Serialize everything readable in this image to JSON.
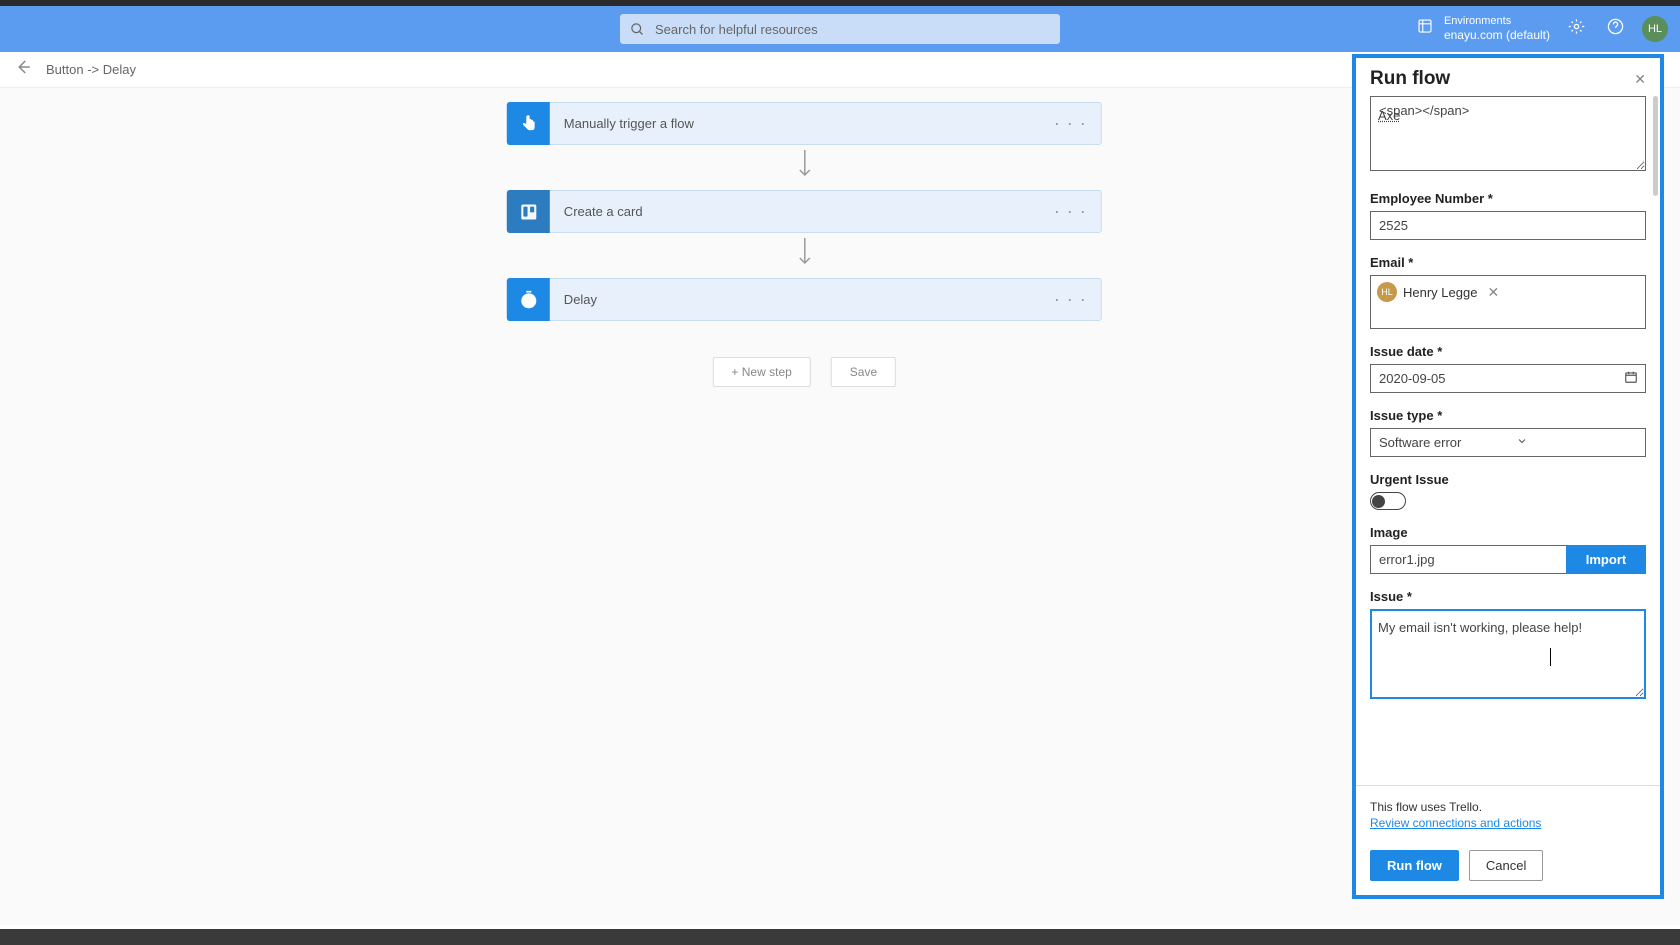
{
  "header": {
    "search_placeholder": "Search for helpful resources",
    "env_label": "Environments",
    "env_value": "enayu.com (default)",
    "avatar_initials": "HL"
  },
  "breadcrumb": {
    "text": "Button -> Delay"
  },
  "flow": {
    "steps": [
      {
        "label": "Manually trigger a flow",
        "icon": "touch"
      },
      {
        "label": "Create a card",
        "icon": "trello"
      },
      {
        "label": "Delay",
        "icon": "clock"
      }
    ],
    "new_step": "+ New step",
    "save": "Save"
  },
  "panel": {
    "title": "Run flow",
    "top_text": "Axe",
    "emp_num_label": "Employee Number *",
    "emp_num_value": "2525",
    "email_label": "Email *",
    "email_pill": "Henry Legge",
    "email_pill_initials": "HL",
    "issue_date_label": "Issue date *",
    "issue_date_value": "2020-09-05",
    "issue_type_label": "Issue type *",
    "issue_type_value": "Software error",
    "urgent_label": "Urgent Issue",
    "image_label": "Image",
    "image_value": "error1.jpg",
    "import_btn": "Import",
    "issue_label": "Issue *",
    "issue_value": "My email isn't working, please help!",
    "foot_text": "This flow uses Trello.",
    "foot_link": "Review connections and actions",
    "run_btn": "Run flow",
    "cancel_btn": "Cancel"
  }
}
